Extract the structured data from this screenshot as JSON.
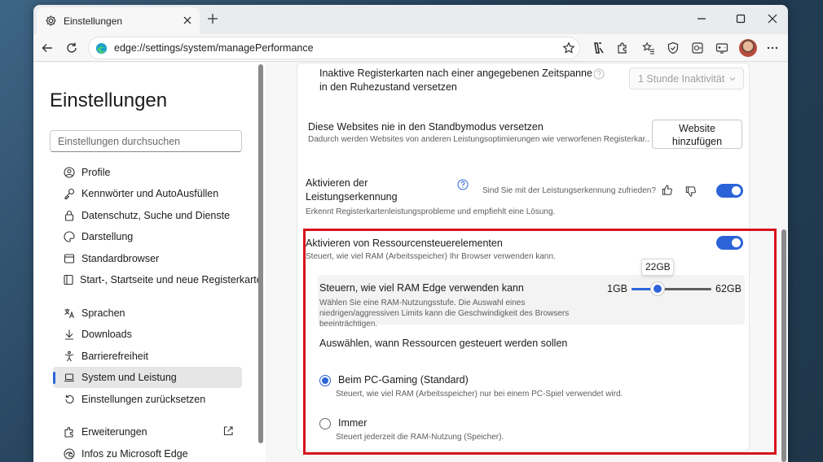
{
  "browser": {
    "tab_title": "Einstellungen",
    "url": "edge://settings/system/managePerformance"
  },
  "sidebar": {
    "title": "Einstellungen",
    "search_placeholder": "Einstellungen durchsuchen",
    "items": [
      {
        "label": "Profile",
        "icon": "profile-icon"
      },
      {
        "label": "Kennwörter und AutoAusfüllen",
        "icon": "key-icon"
      },
      {
        "label": "Datenschutz, Suche und Dienste",
        "icon": "lock-icon"
      },
      {
        "label": "Darstellung",
        "icon": "appearance-icon"
      },
      {
        "label": "Standardbrowser",
        "icon": "browser-icon"
      },
      {
        "label": "Start-, Startseite und neue Registerkarte",
        "icon": "home-tab-icon"
      },
      {
        "label": "Sprachen",
        "icon": "language-icon"
      },
      {
        "label": "Downloads",
        "icon": "download-icon"
      },
      {
        "label": "Barrierefreiheit",
        "icon": "accessibility-icon"
      },
      {
        "label": "System und Leistung",
        "icon": "laptop-icon",
        "active": true
      },
      {
        "label": "Einstellungen zurücksetzen",
        "icon": "reset-icon"
      },
      {
        "label": "Erweiterungen",
        "icon": "extensions-icon"
      },
      {
        "label": "Infos zu Microsoft Edge",
        "icon": "edge-icon"
      }
    ]
  },
  "settings": {
    "inactive_tabs_label": "Inaktive Registerkarten nach einer angegebenen Zeitspanne in den Ruhezustand versetzen",
    "inactive_tabs_value": "1 Stunde Inaktivität",
    "never_sleep_title": "Diese Websites nie in den Standbymodus versetzen",
    "never_sleep_desc": "Dadurch werden Websites von anderen Leistungsoptimierungen wie verworfenen Registerkar...",
    "add_site_button": "Website hinzufügen",
    "perf_detect_title": "Aktivieren der Leistungserkennung",
    "perf_detect_feedback": "Sind Sie mit der Leistungserkennung zufrieden?",
    "perf_detect_desc": "Erkennt Registerkartenleistungsprobleme und empfiehlt eine Lösung.",
    "perf_detect_enabled": true,
    "resource_title": "Aktivieren von Ressourcensteuerelementen",
    "resource_desc": "Steuert, wie viel RAM (Arbeitsspeicher) Ihr Browser verwenden kann.",
    "resource_enabled": true,
    "ram_title": "Steuern, wie viel RAM Edge verwenden kann",
    "ram_desc": "Wählen Sie eine RAM-Nutzungsstufe. Die Auswahl eines niedrigen/aggressiven Limits kann die Geschwindigkeit des Browsers beeinträchtigen.",
    "ram_min": "1GB",
    "ram_max": "62GB",
    "ram_value": "22GB",
    "ram_fraction": 0.33,
    "when_title": "Auswählen, wann Ressourcen gesteuert werden sollen",
    "option_gaming_label": "Beim PC-Gaming (Standard)",
    "option_gaming_desc": "Steuert, wie viel RAM (Arbeitsspeicher) nur bei einem PC-Spiel verwendet wird.",
    "option_always_label": "Immer",
    "option_always_desc": "Steuert jederzeit die RAM-Nutzung (Speicher).",
    "selected_option": "gaming"
  },
  "colors": {
    "accent": "#2d63d8",
    "highlight": "#d6131c"
  }
}
